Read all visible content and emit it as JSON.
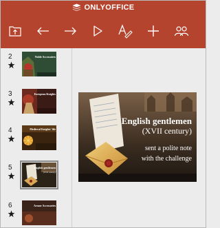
{
  "app": {
    "brand_name": "ONLYOFFICE",
    "brand_color": "#b5442e"
  },
  "toolbar": {
    "buttons": [
      {
        "name": "open-document-icon"
      },
      {
        "name": "undo-icon"
      },
      {
        "name": "redo-icon"
      },
      {
        "name": "play-icon"
      },
      {
        "name": "edit-text-icon"
      },
      {
        "name": "add-icon"
      },
      {
        "name": "users-icon"
      }
    ]
  },
  "slides": [
    {
      "number": "2",
      "title": "Noble Accessoires",
      "subtitle": "",
      "background": "green",
      "selected": false
    },
    {
      "number": "3",
      "title": "European Knights",
      "subtitle": "",
      "background": "red",
      "selected": false
    },
    {
      "number": "4",
      "title": "Medieval Knights' life",
      "subtitle": "",
      "background": "gold",
      "selected": false
    },
    {
      "number": "5",
      "title": "English gentlemen",
      "subtitle": "(XVII century)",
      "background": "letter",
      "selected": true
    },
    {
      "number": "6",
      "title": "Armor Accessories",
      "subtitle": "",
      "background": "warm",
      "selected": false
    }
  ],
  "current_slide": {
    "title": "English gentlemen",
    "subtitle": "(XVII century)",
    "line1": "sent a polite note",
    "line2": "with the challenge"
  }
}
